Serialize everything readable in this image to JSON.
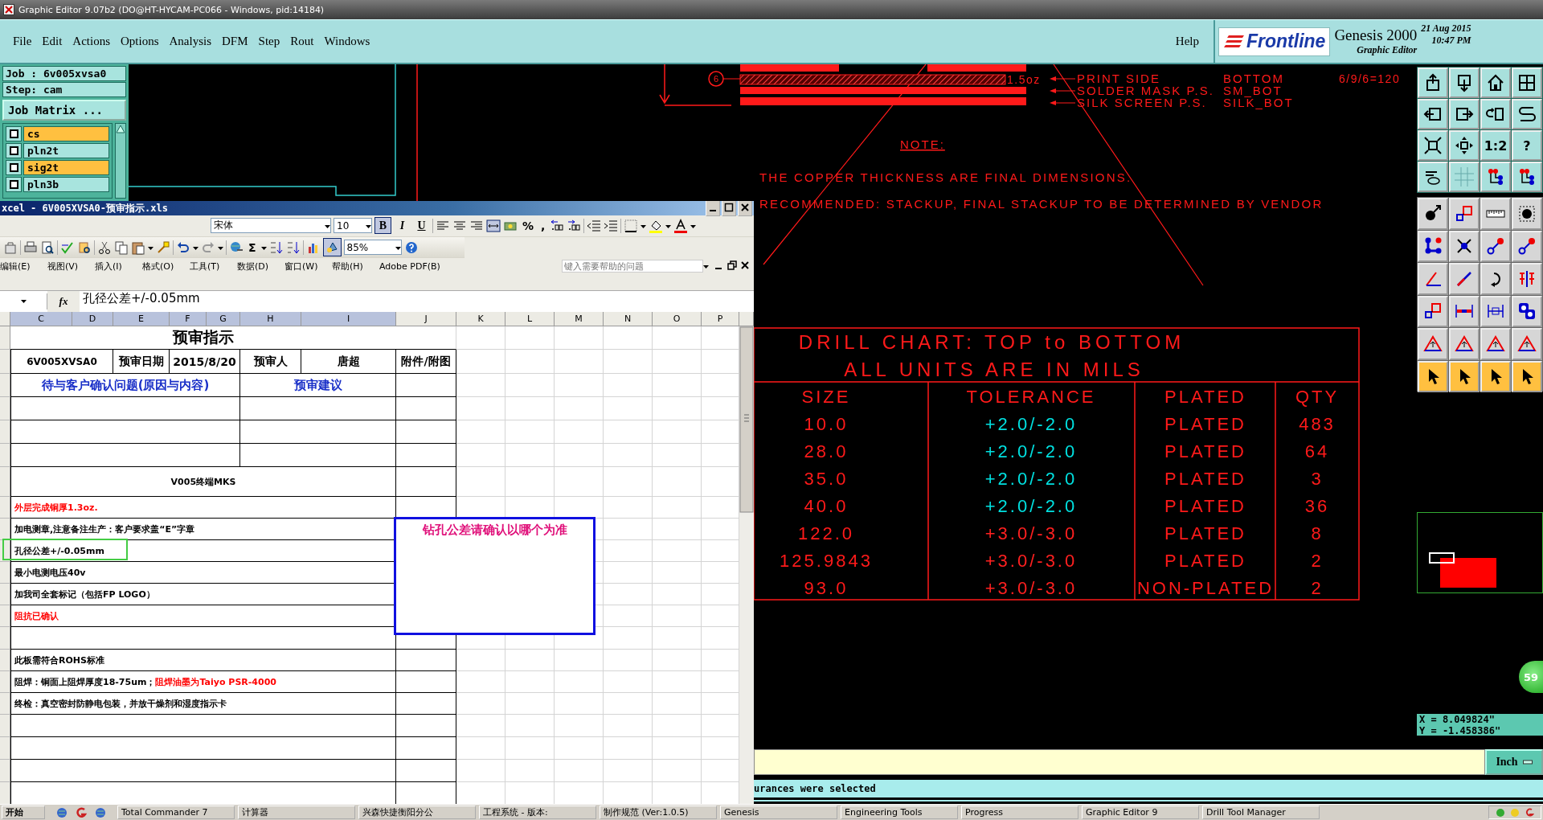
{
  "window": {
    "title": "Graphic Editor 9.07b2 (DO@HT-HYCAM-PC066 - Windows, pid:14184)"
  },
  "menu": [
    "File",
    "Edit",
    "Actions",
    "Options",
    "Analysis",
    "DFM",
    "Step",
    "Rout",
    "Windows"
  ],
  "help": "Help",
  "brand": {
    "logo": "Frontline",
    "product": "Genesis 2000",
    "subtitle": "Graphic Editor",
    "date": "21 Aug 2015",
    "time": "10:47 PM"
  },
  "job_panel": {
    "job": "Job : 6v005xvsa0",
    "step": "Step: cam",
    "matrix_button": "Job Matrix ...",
    "layers": [
      {
        "name": "cs",
        "selected": true,
        "checked": true
      },
      {
        "name": "pln2t",
        "selected": false,
        "checked": true
      },
      {
        "name": "sig2t",
        "selected": true,
        "checked": true
      },
      {
        "name": "pln3b",
        "selected": false,
        "checked": true
      }
    ]
  },
  "drawing": {
    "callout": "6",
    "weight": "1.5oz",
    "legend": [
      {
        "label": "PRINT SIDE",
        "value": "BOTTOM"
      },
      {
        "label": "SOLDER MASK P.S.",
        "value": "SM_BOT"
      },
      {
        "label": "SILK SCREEN P.S.",
        "value": "SILK_BOT"
      }
    ],
    "ratio": "6/9/6=120",
    "note_title": "NOTE:",
    "notes": [
      "THE COPPER THICKNESS ARE FINAL DIMENSIONS.",
      "RECOMMENDED: STACKUP, FINAL STACKUP TO BE DETERMINED BY VENDOR"
    ]
  },
  "drill_chart": {
    "title": "DRILL CHART: TOP to BOTTOM",
    "subtitle": "ALL UNITS ARE IN MILS",
    "columns": [
      "SIZE",
      "TOLERANCE",
      "PLATED",
      "QTY"
    ],
    "rows": [
      {
        "cells": [
          "10.0",
          "+2.0/-2.0",
          "PLATED",
          "483"
        ],
        "color": "#00e0e0"
      },
      {
        "cells": [
          "28.0",
          "+2.0/-2.0",
          "PLATED",
          "64"
        ],
        "color": "#00e0e0"
      },
      {
        "cells": [
          "35.0",
          "+2.0/-2.0",
          "PLATED",
          "3"
        ],
        "color": "#00e0e0"
      },
      {
        "cells": [
          "40.0",
          "+2.0/-2.0",
          "PLATED",
          "36"
        ],
        "color": "#00e0e0"
      },
      {
        "cells": [
          "122.0",
          "+3.0/-3.0",
          "PLATED",
          "8"
        ],
        "color": "#ff2020"
      },
      {
        "cells": [
          "125.9843",
          "+3.0/-3.0",
          "PLATED",
          "2"
        ],
        "color": "#ff2020"
      },
      {
        "cells": [
          "93.0",
          "+3.0/-3.0",
          "NON-PLATED",
          "2"
        ],
        "color": "#ff2020"
      }
    ]
  },
  "toolbox": {
    "text_buttons": [
      "1:2",
      "?"
    ],
    "badge": "59",
    "coords": {
      "x": "X = 8.049824\"",
      "y": "Y = -1.458386\""
    }
  },
  "command_line": {
    "unit_button": "Inch"
  },
  "status": "urances were selected",
  "excel": {
    "title": "xcel - 6V005XVSA0-预审指示.xls",
    "font": "宋体",
    "size": "10",
    "format_buttons": [
      {
        "label": "B",
        "selected": true
      },
      {
        "label": "I",
        "selected": false
      },
      {
        "label": "U",
        "selected": false
      }
    ],
    "number_buttons": [
      "%",
      ","
    ],
    "autosum": "Σ",
    "zoom": "85%",
    "menu": [
      "编辑(E)",
      "视图(V)",
      "插入(I)",
      "格式(O)",
      "工具(T)",
      "数据(D)",
      "窗口(W)",
      "帮助(H)",
      "Adobe PDF(B)"
    ],
    "help_placeholder": "键入需要帮助的问题",
    "fx": "fx",
    "formula": "孔径公差+/-0.05mm",
    "columns": [
      {
        "label": "C",
        "selected": true
      },
      {
        "label": "D",
        "selected": true
      },
      {
        "label": "E",
        "selected": true
      },
      {
        "label": "F",
        "selected": true
      },
      {
        "label": "G",
        "selected": true
      },
      {
        "label": "H",
        "selected": true
      },
      {
        "label": "I",
        "selected": true
      },
      {
        "label": "J",
        "selected": false
      },
      {
        "label": "K",
        "selected": false
      },
      {
        "label": "L",
        "selected": false
      },
      {
        "label": "M",
        "selected": false
      },
      {
        "label": "N",
        "selected": false
      },
      {
        "label": "O",
        "selected": false
      },
      {
        "label": "P",
        "selected": false
      }
    ],
    "rows": [
      {
        "kind": "title",
        "text": "预审指示"
      },
      {
        "kind": "info",
        "cells": [
          "6V005XVSA0",
          "预审日期",
          "2015/8/20",
          "预审人",
          "唐超",
          "附件/附图"
        ]
      },
      {
        "kind": "header",
        "cells": [
          "待与客户确认问题(原因与内容)",
          "预审建议"
        ]
      },
      {
        "kind": "pair"
      },
      {
        "kind": "pair"
      },
      {
        "kind": "pair"
      },
      {
        "kind": "note",
        "text": "V005终端MKS"
      },
      {
        "kind": "item",
        "text": "外层完成铜厚1.3oz.",
        "color": "#ff0000",
        "selected": false
      },
      {
        "kind": "item",
        "text": "加电测章,注意备注生产：客户要求盖“E”字章",
        "color": "#000000",
        "selected": false
      },
      {
        "kind": "item",
        "text": "孔径公差+/-0.05mm",
        "color": "#000000",
        "selected": true
      },
      {
        "kind": "item",
        "text": "最小电测电压40v",
        "color": "#000000",
        "selected": false
      },
      {
        "kind": "item",
        "text": "加我司全套标记（包括FP LOGO）",
        "color": "#000000",
        "selected": false
      },
      {
        "kind": "item",
        "text": "阻抗已确认",
        "color": "#ff0000",
        "selected": false
      },
      {
        "kind": "empty"
      },
      {
        "kind": "item",
        "text": "此板需符合ROHS标准",
        "color": "#000000",
        "selected": false
      },
      {
        "kind": "item",
        "parts": [
          {
            "text": "阻焊：铜面上阻焊厚度18-75um；",
            "color": "#000000"
          },
          {
            "text": "阻焊油墨为Taiyo PSR-4000",
            "color": "#ff0000"
          }
        ],
        "selected": false
      },
      {
        "kind": "item",
        "text": "终检：真空密封防静电包装，并放干燥剂和湿度指示卡",
        "color": "#000000",
        "selected": false
      },
      {
        "kind": "empty"
      },
      {
        "kind": "empty"
      },
      {
        "kind": "empty"
      },
      {
        "kind": "empty"
      }
    ],
    "comment": "钻孔公差请确认以哪个为准"
  },
  "taskbar": {
    "start": "开始",
    "items": [
      "Total Commander 7",
      "计算器",
      "兴森快捷衡阳分公",
      "工程系统 - 版本:",
      "制作规范 (Ver:1.0.5)",
      "Genesis",
      "Engineering Tools",
      "Progress",
      "Graphic Editor 9",
      "Drill Tool Manager"
    ]
  }
}
